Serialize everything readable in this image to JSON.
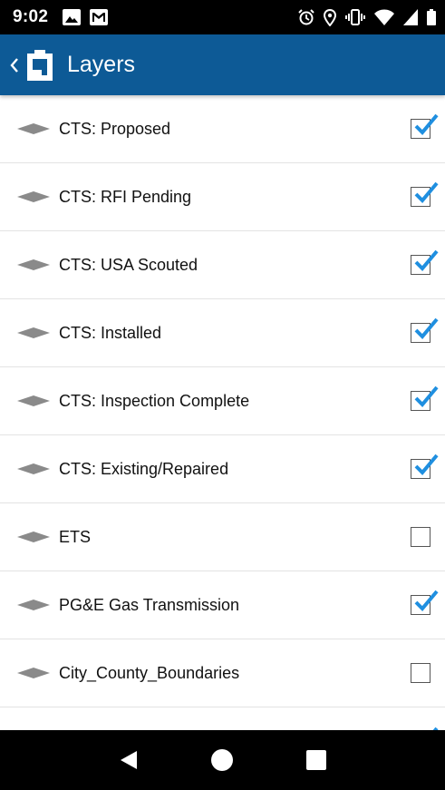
{
  "status_bar": {
    "time": "9:02",
    "left_icons": [
      "image-notification-icon",
      "gmail-notification-icon"
    ],
    "right_icons": [
      "alarm-icon",
      "location-icon",
      "vibrate-icon",
      "wifi-icon",
      "signal-icon",
      "battery-icon"
    ]
  },
  "app_bar": {
    "title": "Layers",
    "background_color": "#0d5a96"
  },
  "layers": [
    {
      "label": "CTS: Proposed",
      "checked": true
    },
    {
      "label": "CTS: RFI Pending",
      "checked": true
    },
    {
      "label": "CTS: USA Scouted",
      "checked": true
    },
    {
      "label": "CTS: Installed",
      "checked": true
    },
    {
      "label": "CTS: Inspection Complete",
      "checked": true
    },
    {
      "label": "CTS: Existing/Repaired",
      "checked": true
    },
    {
      "label": "ETS",
      "checked": false
    },
    {
      "label": "PG&E Gas Transmission",
      "checked": true
    },
    {
      "label": "City_County_Boundaries",
      "checked": false
    },
    {
      "label": "",
      "checked": true
    }
  ],
  "colors": {
    "checkmark": "#1f8fe0",
    "drag_handle": "#8a8a8a"
  },
  "nav_bar": {
    "buttons": [
      "back-icon",
      "home-icon",
      "recents-icon"
    ]
  }
}
